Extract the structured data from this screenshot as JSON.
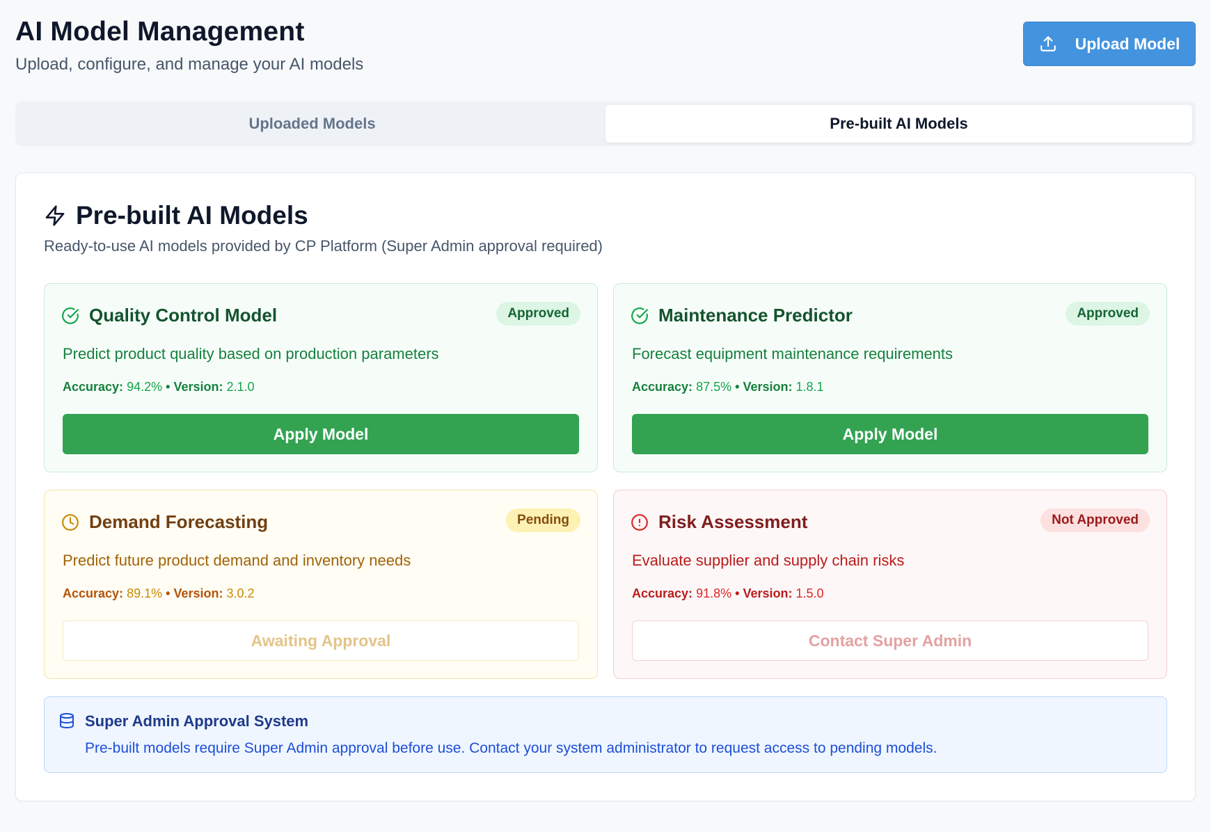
{
  "header": {
    "title": "AI Model Management",
    "subtitle": "Upload, configure, and manage your AI models",
    "upload_label": "Upload Model"
  },
  "tabs": [
    {
      "label": "Uploaded Models",
      "active": false
    },
    {
      "label": "Pre-built AI Models",
      "active": true
    }
  ],
  "section": {
    "title": "Pre-built AI Models",
    "description": "Ready-to-use AI models provided by CP Platform (Super Admin approval required)"
  },
  "labels": {
    "accuracy": "Accuracy:",
    "version": "Version:",
    "separator": "•"
  },
  "models": [
    {
      "name": "Quality Control Model",
      "status": "Approved",
      "description": "Predict product quality based on production parameters",
      "accuracy": "94.2%",
      "version": "2.1.0",
      "action": "Apply Model",
      "icon": "check-circle-icon",
      "color": "#33a352"
    },
    {
      "name": "Maintenance Predictor",
      "status": "Approved",
      "description": "Forecast equipment maintenance requirements",
      "accuracy": "87.5%",
      "version": "1.8.1",
      "action": "Apply Model",
      "icon": "check-circle-icon",
      "color": "#33a352"
    },
    {
      "name": "Demand Forecasting",
      "status": "Pending",
      "description": "Predict future product demand and inventory needs",
      "accuracy": "89.1%",
      "version": "3.0.2",
      "action": "Awaiting Approval",
      "icon": "clock-icon",
      "color": "#ca8a04"
    },
    {
      "name": "Risk Assessment",
      "status": "Not Approved",
      "description": "Evaluate supplier and supply chain risks",
      "accuracy": "91.8%",
      "version": "1.5.0",
      "action": "Contact Super Admin",
      "icon": "alert-circle-icon",
      "color": "#dc2626"
    }
  ],
  "info": {
    "title": "Super Admin Approval System",
    "text": "Pre-built models require Super Admin approval before use. Contact your system administrator to request access to pending models."
  }
}
